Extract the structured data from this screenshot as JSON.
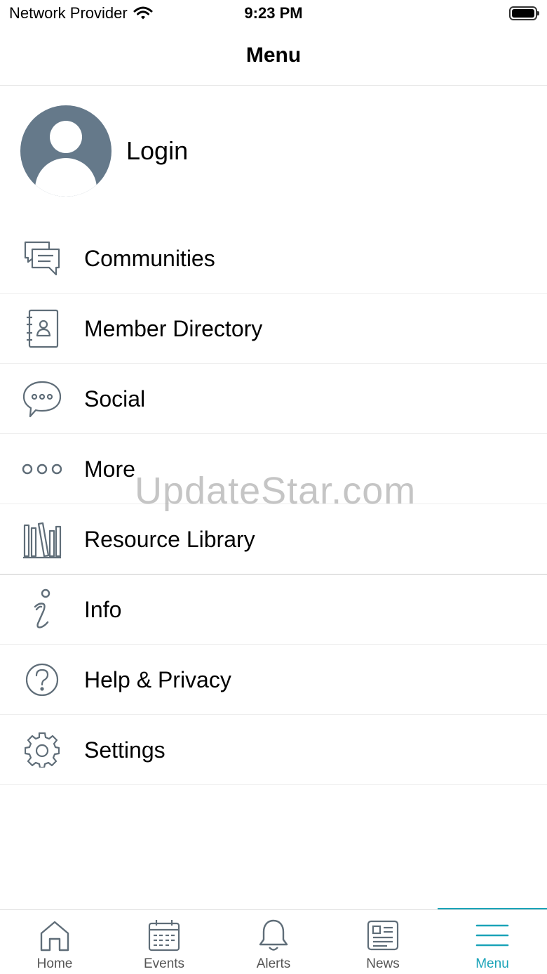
{
  "status_bar": {
    "carrier": "Network Provider",
    "time": "9:23 PM"
  },
  "nav": {
    "title": "Menu"
  },
  "login": {
    "label": "Login"
  },
  "menu_items": [
    {
      "label": "Communities",
      "icon": "chat-bubbles-icon"
    },
    {
      "label": "Member Directory",
      "icon": "address-book-icon"
    },
    {
      "label": "Social",
      "icon": "speech-bubble-icon"
    },
    {
      "label": "More",
      "icon": "more-dots-icon"
    },
    {
      "label": "Resource Library",
      "icon": "books-icon"
    },
    {
      "label": "Info",
      "icon": "info-icon"
    },
    {
      "label": "Help & Privacy",
      "icon": "question-icon"
    },
    {
      "label": "Settings",
      "icon": "gear-icon"
    }
  ],
  "watermark": "UpdateStar.com",
  "tabs": [
    {
      "label": "Home",
      "icon": "home-icon"
    },
    {
      "label": "Events",
      "icon": "calendar-icon"
    },
    {
      "label": "Alerts",
      "icon": "bell-icon"
    },
    {
      "label": "News",
      "icon": "newspaper-icon"
    },
    {
      "label": "Menu",
      "icon": "menu-icon",
      "active": true
    }
  ],
  "colors": {
    "accent": "#1aa3b8",
    "icon": "#5f6d78",
    "avatar": "#65798a"
  }
}
